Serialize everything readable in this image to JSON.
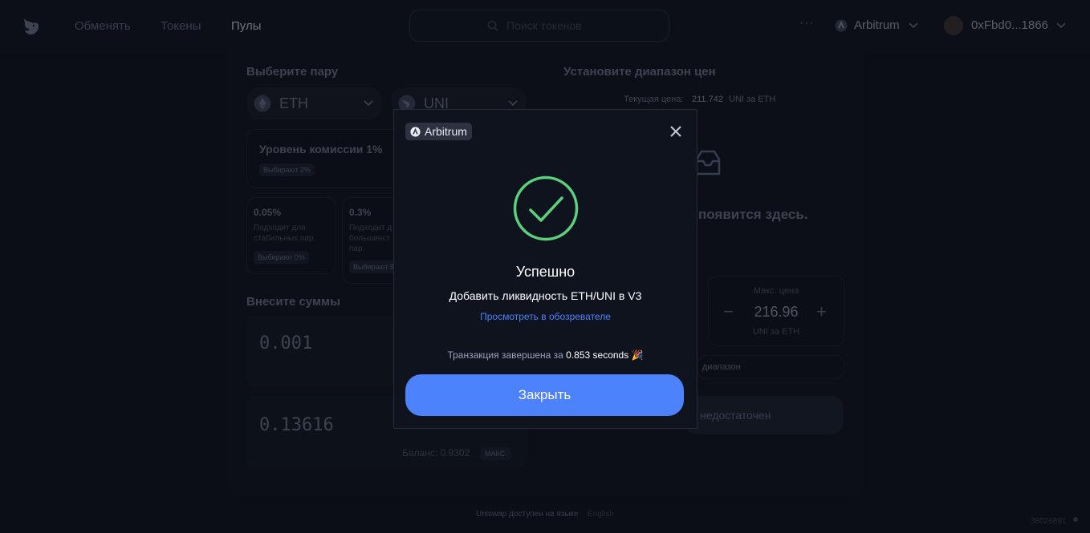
{
  "header": {
    "nav": [
      "Обменять",
      "Токены",
      "Пулы"
    ],
    "search_placeholder": "Поиск токенов",
    "more": "···",
    "network": "Arbitrum",
    "account": "0xFbd0...1866"
  },
  "background": {
    "pair_title": "Выберите пару",
    "token_a": "ETH",
    "token_b": "UNI",
    "fee_tier_title": "Уровень комиссии 1%",
    "fee_tier_badge": "Выбирают 2%",
    "fee_options": [
      {
        "pct": "0.05%",
        "desc1": "Подходит для",
        "desc2": "стабильных пар.",
        "badge": "Выбирают 0%"
      },
      {
        "pct": "0.3%",
        "desc1": "Подходит д",
        "desc2": "большинст",
        "desc3": "пар.",
        "badge": "Выбирают 9"
      }
    ],
    "deposit_title": "Внесите суммы",
    "amount_a": "0.001",
    "amount_b": "0.13616",
    "balance_label": "Баланс: 0.9302",
    "max_badge": "МАКС.",
    "range_title": "Установите диапазон цен",
    "current_price_label": "Текущая цена:",
    "current_price_value": "211.742",
    "current_price_unit": "UNI за ETH",
    "position_hint": "появится здесь.",
    "max_price_label": "Макс. цена",
    "max_price_value": "216.96",
    "max_price_unit": "UNI за ETH",
    "full_range": "диапазон",
    "insufficient": "недостаточен",
    "footer_text": "Uniswap доступен на языке",
    "footer_lang": "English",
    "block_number": "38026891"
  },
  "modal": {
    "network": "Arbitrum",
    "title": "Успешно",
    "description": "Добавить ликвидность ETH/UNI в V3",
    "explorer_link": "Просмотреть в обозревателе",
    "tx_prefix": "Транзакция завершена за",
    "tx_time": "0.853 seconds",
    "tx_emoji": "🎉",
    "close_label": "Закрыть"
  },
  "colors": {
    "accent": "#4c82fb",
    "success": "#5cd17d",
    "background": "#0d111c"
  }
}
